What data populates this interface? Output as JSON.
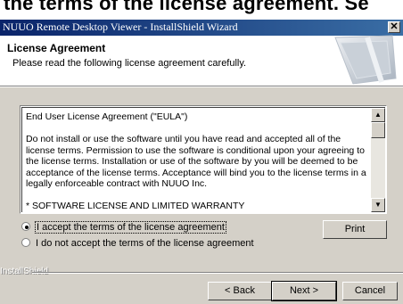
{
  "banner": {
    "text": "the terms of the license agreement. Se"
  },
  "window": {
    "title": "NUUO Remote Desktop Viewer - InstallShield Wizard",
    "close_glyph": "✕"
  },
  "header": {
    "title": "License Agreement",
    "subtitle": "Please read the following license agreement carefully."
  },
  "license": {
    "text": "End User License Agreement (\"EULA\")\n\nDo not install or use the software until you have read and accepted all of the license terms. Permission to use the software is conditional upon your agreeing to the license terms. Installation or use of the software by you will be deemed to be acceptance of the license terms. Acceptance will bind you to the license terms in a legally enforceable contract with NUUO Inc.\n\n* SOFTWARE LICENSE AND LIMITED WARRANTY\nThis is an agreement between you, the end user, and NUUO Inc. (\"NUUO\"). By using this software, you agree to become bound by the terms of this agreement."
  },
  "options": {
    "accept": "I accept the terms of the license agreement",
    "decline": "I do not accept the terms of the license agreement",
    "selected": "accept"
  },
  "buttons": {
    "print": "Print",
    "back": "< Back",
    "next": "Next >",
    "cancel": "Cancel"
  },
  "footer": {
    "brand": "InstallShield"
  },
  "colors": {
    "titlebar_start": "#0a246a",
    "titlebar_end": "#3a6ea5",
    "dialog_bg": "#d4d0c8"
  }
}
